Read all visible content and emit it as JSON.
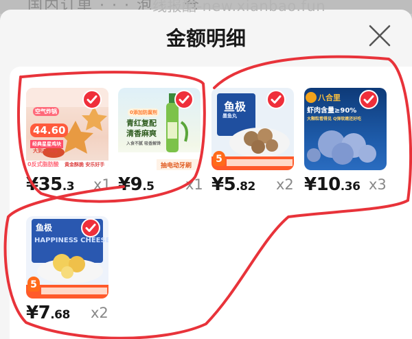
{
  "watermark": "线报酷-new.xianbao.fun",
  "background_title_ghost": "国内订单 · · · 泡 · · 仓",
  "dialog": {
    "title": "金额明细",
    "close_icon": "close-x-icon"
  },
  "items": [
    {
      "selected": true,
      "price_int": "¥35",
      "price_dec": ".3",
      "qty": "x1",
      "thumb_texts": [
        "空气炸锅",
        "44.60",
        "经典星星鸡块",
        "大到1.5kg",
        "0反式脂肪酸",
        "黄金酥脆 安乐好手"
      ]
    },
    {
      "selected": true,
      "price_int": "¥9",
      "price_dec": ".5",
      "qty": "x1",
      "thumb_texts": [
        "0添加防腐剂",
        "青红复配",
        "清香麻爽",
        "入食不腻 吸香解馋",
        "抽电动牙刷"
      ]
    },
    {
      "selected": true,
      "price_int": "¥5",
      "price_dec": ".82",
      "qty": "x2",
      "thumb_texts": [
        "鱼极",
        "墨鱼丸",
        "5"
      ]
    },
    {
      "selected": true,
      "price_int": "¥10",
      "price_dec": ".36",
      "qty": "x3",
      "thumb_texts": [
        "八合里",
        "虾肉含量≥90%",
        "大颗粒看得见 Q弹软嫩还好吃"
      ]
    },
    {
      "selected": true,
      "price_int": "¥7",
      "price_dec": ".68",
      "qty": "x2",
      "thumb_texts": [
        "鱼极",
        "HAPPINESS CHEESE",
        "5"
      ]
    }
  ],
  "annotation_color": "#e8333a",
  "check_color": "#ef2f3a"
}
